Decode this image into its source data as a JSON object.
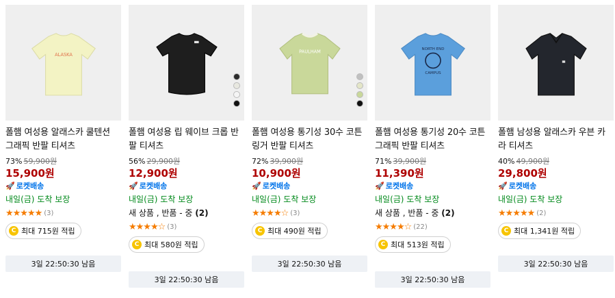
{
  "products": [
    {
      "title": "폴햄 여성용 알래스카 쿨텐션 그래픽 반팔 티셔츠",
      "discount": "73%",
      "original_price": "59,900원",
      "price": "15,900원",
      "delivery_badge": "로켓배송",
      "arrival": "내일(금) 도착 보장",
      "extra": "",
      "extra_count": "",
      "stars": "★★★★★",
      "rating_count": "(3)",
      "points": "최대 715원 적립",
      "timer": "3일 22:50:30 남음",
      "shirt_color": "#f3f3c4",
      "swatches": []
    },
    {
      "title": "폴햄 여성용 립 웨이브 크롭 반팔 티셔츠",
      "discount": "56%",
      "original_price": "29,900원",
      "price": "12,900원",
      "delivery_badge": "로켓배송",
      "arrival": "내일(금) 도착 보장",
      "extra": "새 상품 , 반품 - 중",
      "extra_count": "(2)",
      "stars": "★★★★☆",
      "rating_count": "(3)",
      "points": "최대 580원 적립",
      "timer": "3일 22:50:30 남음",
      "shirt_color": "#1e1e1e",
      "swatches": [
        "#2b2b2b",
        "#e8e8e0",
        "#f5f5f5",
        "#111111"
      ]
    },
    {
      "title": "폴햄 여성용 통기성 30수 코튼 링거 반팔 티셔츠",
      "discount": "72%",
      "original_price": "39,900원",
      "price": "10,900원",
      "delivery_badge": "로켓배송",
      "arrival": "내일(금) 도착 보장",
      "extra": "",
      "extra_count": "",
      "stars": "★★★★☆",
      "rating_count": "(3)",
      "points": "최대 490원 적립",
      "timer": "3일 22:50:30 남음",
      "shirt_color": "#c9d89a",
      "swatches": [
        "#c0c0c0",
        "#e4e6c8",
        "#c9d89a",
        "#111111"
      ]
    },
    {
      "title": "폴햄 여성용 통기성 20수 코튼 그래픽 반팔 티셔츠",
      "discount": "71%",
      "original_price": "39,900원",
      "price": "11,390원",
      "delivery_badge": "로켓배송",
      "arrival": "내일(금) 도착 보장",
      "extra": "새 상품 , 반품 - 중",
      "extra_count": "(2)",
      "stars": "★★★★☆",
      "rating_count": "(22)",
      "points": "최대 513원 적립",
      "timer": "3일 22:50:30 남음",
      "shirt_color": "#5b9fdc",
      "swatches": []
    },
    {
      "title": "폴햄 남성용 알래스카 우븐 카라 티셔츠",
      "discount": "40%",
      "original_price": "49,900원",
      "price": "29,800원",
      "delivery_badge": "로켓배송",
      "arrival": "내일(금) 도착 보장",
      "extra": "",
      "extra_count": "",
      "stars": "★★★★★",
      "rating_count": "(2)",
      "points": "최대 1,341원 적립",
      "timer": "3일 22:50:30 남음",
      "shirt_color": "#23262d",
      "swatches": []
    }
  ],
  "icons": {
    "coin": "C",
    "rocket": "🚀"
  },
  "colors": {
    "price": "#ae0000",
    "rocket": "#0073e9",
    "arrival": "#00891a",
    "stars": "#f57c00"
  }
}
